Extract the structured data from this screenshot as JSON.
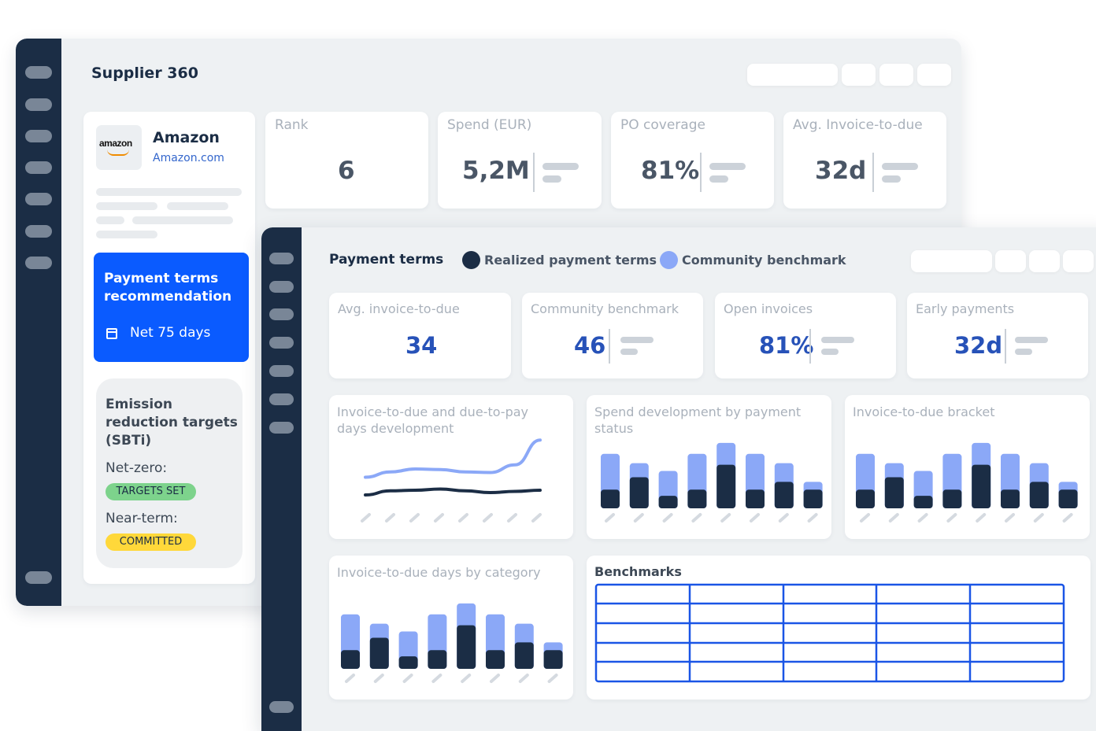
{
  "supplier360": {
    "title": "Supplier 360",
    "supplier": {
      "name": "Amazon",
      "url": "Amazon.com",
      "logo_text": "amazon"
    },
    "kpis": [
      {
        "label": "Rank",
        "value": "6"
      },
      {
        "label": "Spend (EUR)",
        "value": "5,2M"
      },
      {
        "label": "PO coverage",
        "value": "81%"
      },
      {
        "label": "Avg. Invoice-to-due",
        "value": "32d"
      }
    ],
    "recommendation": {
      "title": "Payment terms recommendation",
      "value": "Net 75 days",
      "icon": "calendar-icon"
    },
    "emission": {
      "title": "Emission reduction targets (SBTi)",
      "net_zero_label": "Net-zero:",
      "net_zero_status": "TARGETS SET",
      "near_term_label": "Near-term:",
      "near_term_status": "COMMITTED"
    }
  },
  "payment_terms": {
    "title": "Payment terms",
    "legend": [
      {
        "label": "Realized payment terms",
        "color": "#1b2d45"
      },
      {
        "label": "Community benchmark",
        "color": "#8ba8f7"
      }
    ],
    "kpis": [
      {
        "label": "Avg. invoice-to-due",
        "value": "34"
      },
      {
        "label": "Community benchmark",
        "value": "46"
      },
      {
        "label": "Open invoices",
        "value": "81%"
      },
      {
        "label": "Early payments",
        "value": "32d"
      }
    ],
    "benchmarks_title": "Benchmarks"
  },
  "colors": {
    "navy": "#1b2d45",
    "accent_blue": "#0a5bff",
    "benchmark_blue": "#8ba8f7",
    "targets_set": "#7dd38c",
    "committed": "#ffd83a"
  },
  "chart_data": [
    {
      "type": "line",
      "title": "Invoice-to-due and due-to-pay days development",
      "x": [
        1,
        2,
        3,
        4,
        5,
        6,
        7,
        8
      ],
      "series": [
        {
          "values": [
            4.2,
            5.1,
            5.6,
            5.5,
            5.1,
            5.0,
            6.3,
            10.5
          ]
        },
        {
          "values": [
            1.2,
            1.9,
            2.0,
            2.2,
            1.9,
            1.6,
            1.8,
            2.0
          ]
        }
      ],
      "ylim": [
        0,
        12
      ]
    },
    {
      "type": "bar",
      "title": "Spend development by payment status",
      "categories": [
        "",
        "",
        "",
        "",
        "",
        "",
        "",
        ""
      ],
      "series": [
        {
          "values": [
            24,
            40,
            16,
            24,
            56,
            24,
            34,
            24
          ]
        },
        {
          "values": [
            70,
            58,
            48,
            70,
            84,
            70,
            58,
            34
          ]
        }
      ],
      "ylim": [
        0,
        90
      ]
    },
    {
      "type": "bar",
      "title": "Invoice-to-due bracket",
      "categories": [
        "",
        "",
        "",
        "",
        "",
        "",
        "",
        ""
      ],
      "series": [
        {
          "values": [
            24,
            40,
            16,
            24,
            56,
            24,
            34,
            24
          ]
        },
        {
          "values": [
            70,
            58,
            48,
            70,
            84,
            70,
            58,
            34
          ]
        }
      ],
      "ylim": [
        0,
        90
      ]
    },
    {
      "type": "bar",
      "title": "Invoice-to-due days by category",
      "categories": [
        "",
        "",
        "",
        "",
        "",
        "",
        "",
        ""
      ],
      "series": [
        {
          "values": [
            24,
            40,
            16,
            24,
            56,
            24,
            34,
            24
          ]
        },
        {
          "values": [
            70,
            58,
            48,
            70,
            84,
            70,
            58,
            34
          ]
        }
      ],
      "ylim": [
        0,
        90
      ]
    }
  ]
}
